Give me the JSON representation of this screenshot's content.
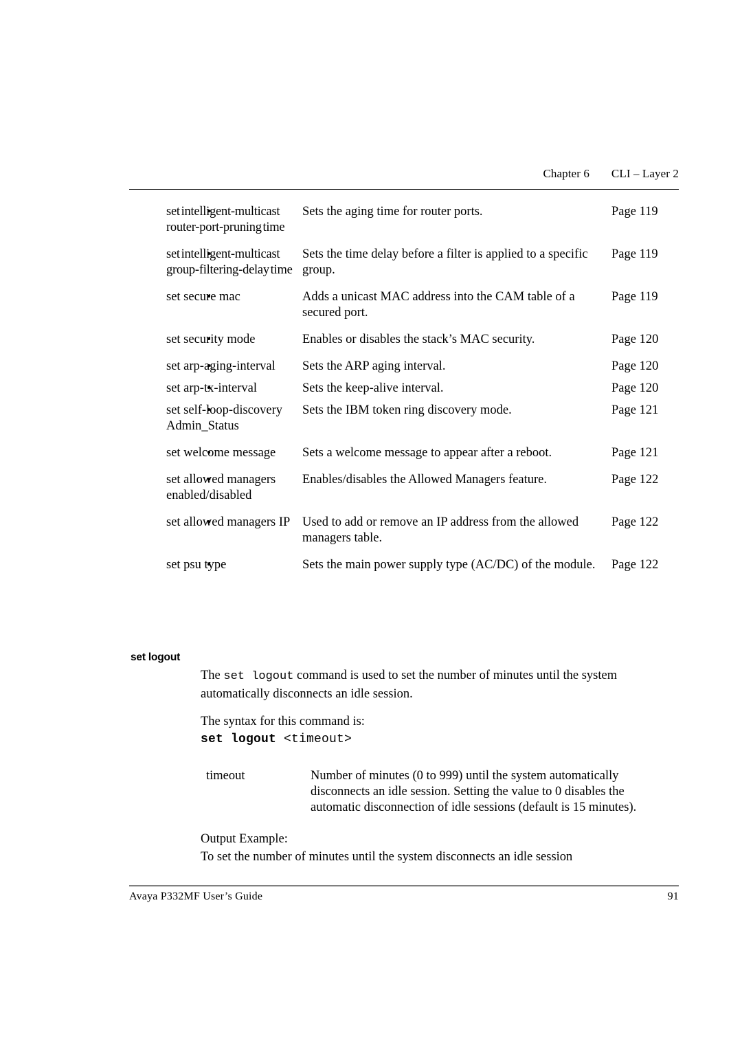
{
  "running_head": {
    "chapter": "Chapter 6",
    "section": "CLI – Layer 2"
  },
  "command_table": {
    "rows": [
      {
        "bullet": "•",
        "command": "set intelligent-multicast router-port-pruning time",
        "description": "Sets the aging time for router ports.",
        "page_ref": "Page 119"
      },
      {
        "bullet": "•",
        "command": "set intelligent-multicast group-filtering-delay time",
        "description": "Sets the time delay before a filter is applied to a specific group.",
        "page_ref": "Page 119"
      },
      {
        "bullet": "•",
        "command": "set secure mac",
        "description": "Adds a unicast MAC address into the CAM table of a secured port.",
        "page_ref": "Page 119"
      },
      {
        "bullet": "•",
        "command": "set security mode",
        "description": "Enables or disables the stack’s MAC security.",
        "page_ref": "Page 120"
      },
      {
        "bullet": "•",
        "command": "set arp-aging-interval",
        "description": "Sets the ARP aging interval.",
        "page_ref": "Page 120"
      },
      {
        "bullet": "•",
        "command": "set arp-tx-interval",
        "description": "Sets the keep-alive interval.",
        "page_ref": "Page 120"
      },
      {
        "bullet": "•",
        "command": "set self-loop-discovery Admin_Status",
        "description": "Sets the IBM token ring discovery mode.",
        "page_ref": "Page 121"
      },
      {
        "bullet": "•",
        "command": "set welcome message",
        "description": "Sets a welcome message to appear after a reboot.",
        "page_ref": "Page 121"
      },
      {
        "bullet": "•",
        "command": "set allowed managers enabled/disabled",
        "description": "Enables/disables the Allowed Managers feature.",
        "page_ref": "Page 122"
      },
      {
        "bullet": "•",
        "command": "set allowed managers IP",
        "description": "Used to add or remove an IP address from the allowed managers table.",
        "page_ref": "Page 122"
      },
      {
        "bullet": "•",
        "command": "set psu type",
        "description": "Sets the main power supply type (AC/DC) of the module.",
        "page_ref": "Page 122"
      }
    ]
  },
  "section": {
    "heading": "set logout",
    "intro_before": "The ",
    "intro_command": "set logout",
    "intro_after": " command is used to set the number of minutes until the system automatically disconnects an idle session.",
    "syntax_lead": "The syntax for this command is:",
    "syntax_command": "set logout",
    "syntax_arg": "<timeout>",
    "param": {
      "term": "timeout",
      "definition": "Number of minutes (0 to 999) until the system automatically disconnects an idle session. Setting the value to 0 disables the automatic disconnection of idle sessions (default is 15 minutes)."
    },
    "output_label": "Output Example:",
    "output_text": "To set the number of minutes until the system disconnects an idle session"
  },
  "footer": {
    "guide_title": "Avaya P332MF User’s Guide",
    "page_number": "91"
  }
}
